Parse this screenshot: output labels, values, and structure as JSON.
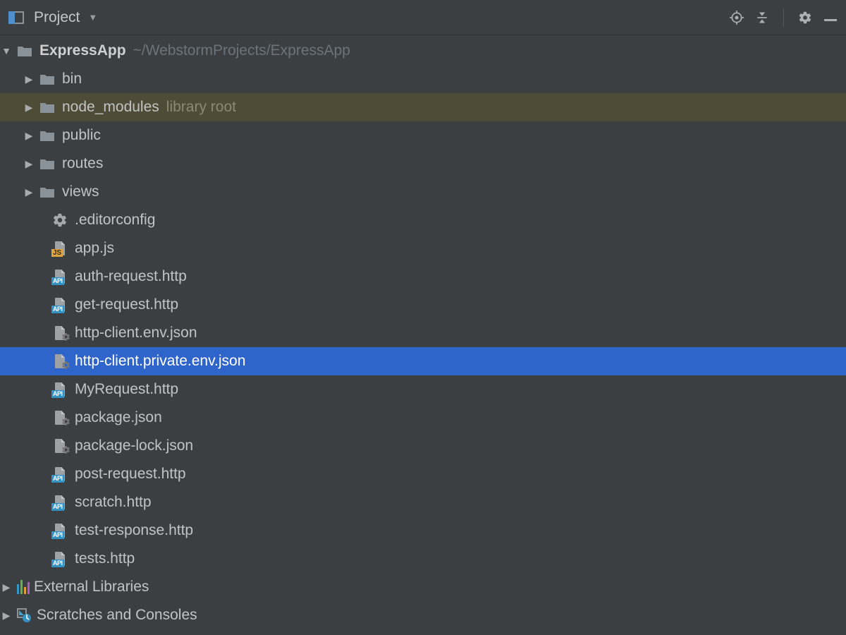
{
  "toolbar": {
    "title": "Project"
  },
  "tree": {
    "root": {
      "name": "ExpressApp",
      "path": "~/WebstormProjects/ExpressApp"
    },
    "folders": [
      {
        "name": "bin"
      },
      {
        "name": "node_modules",
        "note": "library root",
        "highlight": true
      },
      {
        "name": "public"
      },
      {
        "name": "routes"
      },
      {
        "name": "views"
      }
    ],
    "files": [
      {
        "name": ".editorconfig",
        "type": "gear"
      },
      {
        "name": "app.js",
        "type": "js"
      },
      {
        "name": "auth-request.http",
        "type": "api"
      },
      {
        "name": "get-request.http",
        "type": "api"
      },
      {
        "name": "http-client.env.json",
        "type": "json"
      },
      {
        "name": "http-client.private.env.json",
        "type": "json",
        "selected": true
      },
      {
        "name": "MyRequest.http",
        "type": "api"
      },
      {
        "name": "package.json",
        "type": "json"
      },
      {
        "name": "package-lock.json",
        "type": "json"
      },
      {
        "name": "post-request.http",
        "type": "api"
      },
      {
        "name": "scratch.http",
        "type": "api"
      },
      {
        "name": "test-response.http",
        "type": "api"
      },
      {
        "name": "tests.http",
        "type": "api"
      }
    ],
    "external_libraries": "External Libraries",
    "scratches": "Scratches and Consoles"
  }
}
